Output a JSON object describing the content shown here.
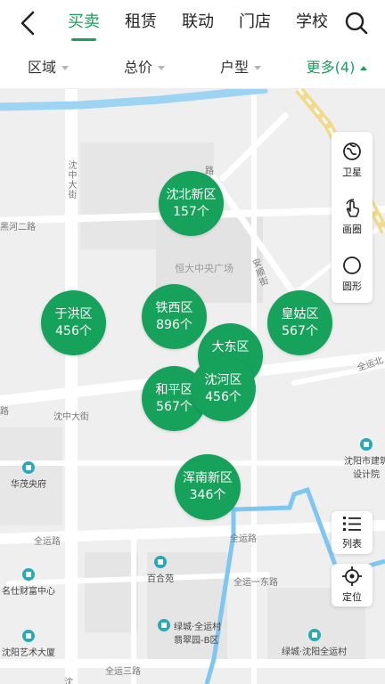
{
  "nav": {
    "tabs": [
      {
        "label": "买卖",
        "active": true
      },
      {
        "label": "租赁",
        "active": false
      },
      {
        "label": "联动",
        "active": false
      },
      {
        "label": "门店",
        "active": false
      },
      {
        "label": "学校",
        "active": false
      }
    ]
  },
  "filters": [
    {
      "label": "区域",
      "active": false
    },
    {
      "label": "总价",
      "active": false
    },
    {
      "label": "户型",
      "active": false
    },
    {
      "label": "更多(4)",
      "active": true
    }
  ],
  "map": {
    "road_labels": {
      "shenzhong_street": "沈中大街",
      "heihe_road": "黑河二路",
      "road_top": "路",
      "anshan_street": "安顺街",
      "quanyun_north": "全运北",
      "shenzhong_street_h": "沈中大街",
      "road_left": "路",
      "quanyun_road": "全运路",
      "quanyun_road2": "全运路",
      "quanyun_1st_east": "全运一东路",
      "quanyun_3rd": "全运三路",
      "bottom_shen": "沈"
    },
    "pois": {
      "hengda_plaza": "恒大中央广场",
      "huamao": "华茂央府",
      "mingshi": "名仕财富中心",
      "shenyang_art": "沈阳艺术大厦",
      "baihe": "百合苑",
      "lvcheng_cuicao": "绿城·全运村\n翡翠园-B区",
      "lvcheng_shenyang": "绿城·沈阳全运村",
      "jianzhu_design": "沈阳市建筑\n设计院"
    },
    "clusters": [
      {
        "name": "沈北新区",
        "count": "157个"
      },
      {
        "name": "于洪区",
        "count": "456个"
      },
      {
        "name": "铁西区",
        "count": "896个"
      },
      {
        "name": "皇姑区",
        "count": "567个"
      },
      {
        "name": "大东区",
        "count": "、"
      },
      {
        "name": "沈河区",
        "count": "456个"
      },
      {
        "name": "和平区",
        "count": "567个"
      },
      {
        "name": "浑南新区",
        "count": "346个"
      }
    ]
  },
  "tools": {
    "satellite": "卫星",
    "draw_circle": "画圈",
    "circle_shape": "圆形",
    "list": "列表",
    "locate": "定位"
  },
  "colors": {
    "brand_green": "#1a9f5d",
    "bubble_green": "#17a25c",
    "river_blue": "#7fc6f0",
    "rail_yellow": "#f3d98c"
  }
}
